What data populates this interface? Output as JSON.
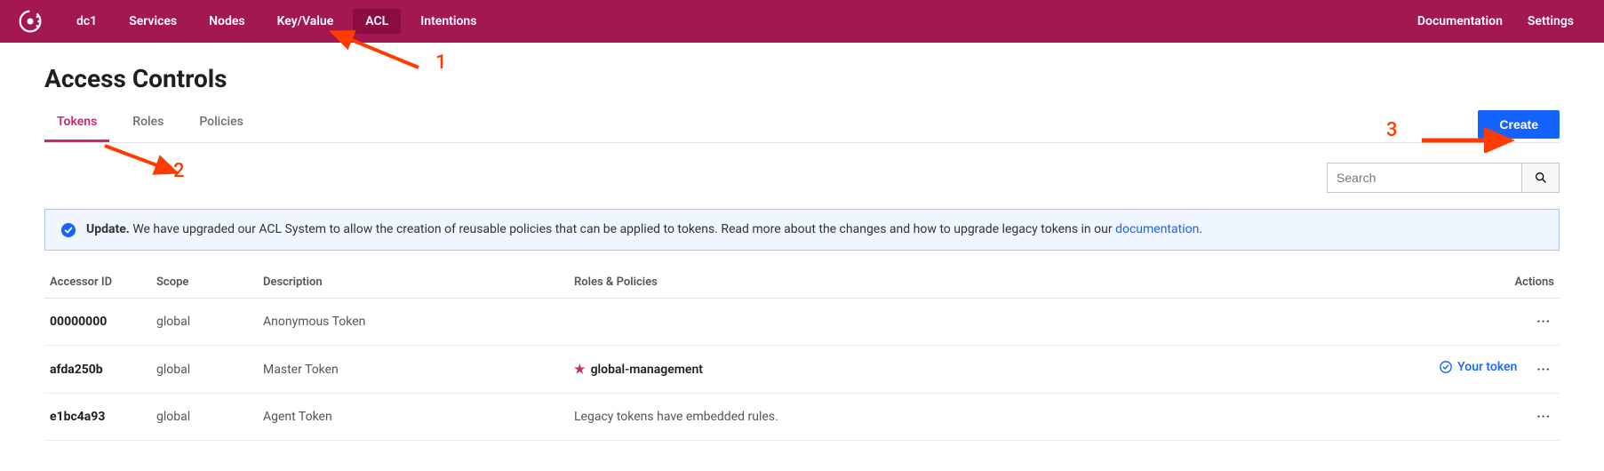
{
  "nav": {
    "datacenter": "dc1",
    "items": [
      "Services",
      "Nodes",
      "Key/Value",
      "ACL",
      "Intentions"
    ],
    "active": "ACL",
    "right": [
      "Documentation",
      "Settings"
    ]
  },
  "page": {
    "title": "Access Controls"
  },
  "tabs": {
    "items": [
      "Tokens",
      "Roles",
      "Policies"
    ],
    "active": "Tokens",
    "create_label": "Create"
  },
  "search": {
    "placeholder": "Search"
  },
  "banner": {
    "strong": "Update.",
    "text1": " We have upgraded our ACL System to allow the creation of reusable policies that can be applied to tokens. Read more about the changes and how to upgrade legacy tokens in our ",
    "link": "documentation",
    "text2": "."
  },
  "table": {
    "headers": {
      "accessor": "Accessor ID",
      "scope": "Scope",
      "description": "Description",
      "roles": "Roles & Policies",
      "actions": "Actions"
    },
    "your_token_label": "Your token",
    "more_glyph": "···",
    "rows": [
      {
        "id": "00000000",
        "scope": "global",
        "description": "Anonymous Token",
        "roles": "",
        "is_legacy": false,
        "is_yours": false
      },
      {
        "id": "afda250b",
        "scope": "global",
        "description": "Master Token",
        "roles": "global-management",
        "is_legacy": false,
        "is_yours": true
      },
      {
        "id": "e1bc4a93",
        "scope": "global",
        "description": "Agent Token",
        "roles": "Legacy tokens have embedded rules.",
        "is_legacy": true,
        "is_yours": false
      }
    ]
  },
  "annotations": {
    "a1": "1",
    "a2": "2",
    "a3": "3"
  },
  "colors": {
    "brand": "#a31852",
    "accent": "#c62a71",
    "primary": "#1563ff"
  }
}
